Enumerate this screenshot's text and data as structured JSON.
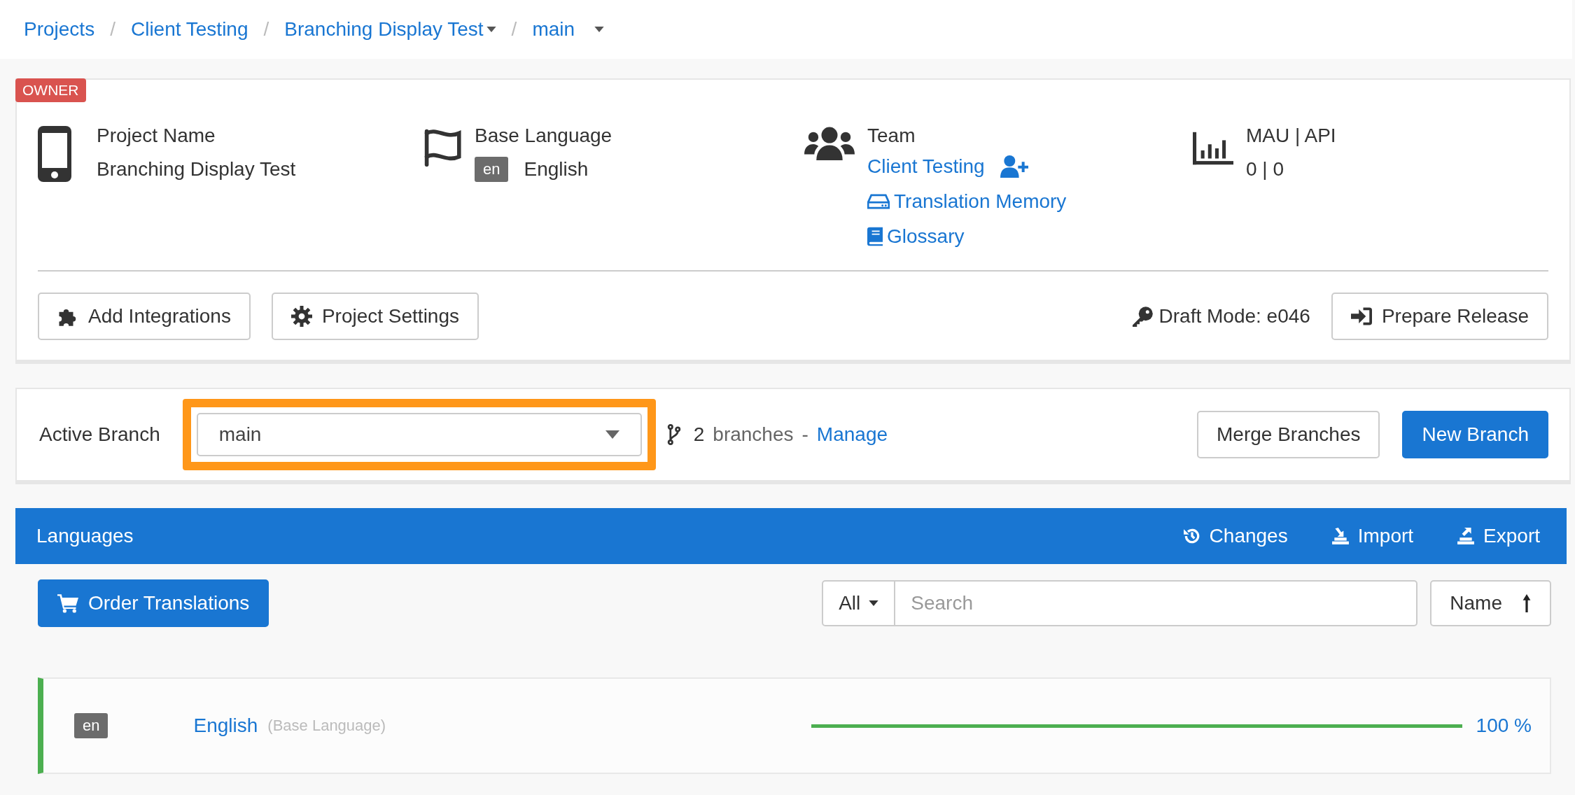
{
  "breadcrumbs": [
    {
      "label": "Projects",
      "dropdown": false
    },
    {
      "separator": "/",
      "label": "Client Testing",
      "dropdown": false
    },
    {
      "separator": "/",
      "label": "Branching Display Test",
      "dropdown": true
    },
    {
      "separator": "/",
      "label": "main",
      "dropdown": true
    }
  ],
  "project": {
    "badge": "OWNER",
    "name": {
      "label": "Project Name",
      "value": "Branching Display Test"
    },
    "base_language": {
      "label": "Base Language",
      "code": "en",
      "value": "English"
    },
    "team": {
      "label": "Team",
      "value": "Client Testing",
      "links": [
        {
          "kind": "memory",
          "label": "Translation Memory"
        },
        {
          "kind": "glossary",
          "label": "Glossary"
        }
      ]
    },
    "usage": {
      "label": "MAU | API",
      "value": "0 | 0"
    },
    "buttons": [
      {
        "kind": "integrations",
        "label": "Add Integrations"
      },
      {
        "kind": "settings",
        "label": "Project Settings"
      }
    ],
    "draft_mode": "Draft Mode: e046",
    "release_button": "Prepare Release"
  },
  "branch": {
    "label": "Active Branch",
    "value": "main",
    "highlighted": true,
    "count": "2",
    "count_label": "branches",
    "separator": "-",
    "manage": "Manage",
    "buttons": [
      {
        "kind": "outline",
        "label": "Merge Branches"
      },
      {
        "kind": "primary",
        "label": "New Branch"
      }
    ]
  },
  "languages": {
    "title": "Languages",
    "actions": [
      {
        "kind": "changes",
        "label": "Changes"
      },
      {
        "kind": "import",
        "label": "Import"
      },
      {
        "kind": "export",
        "label": "Export"
      }
    ],
    "order_button": "Order Translations",
    "filter": "All",
    "search": {
      "placeholder": "Search"
    },
    "sort": "Name",
    "rows": [
      {
        "code": "en",
        "name": "English",
        "note": "(Base Language)",
        "level": 1,
        "percent": "100 %"
      }
    ]
  }
}
